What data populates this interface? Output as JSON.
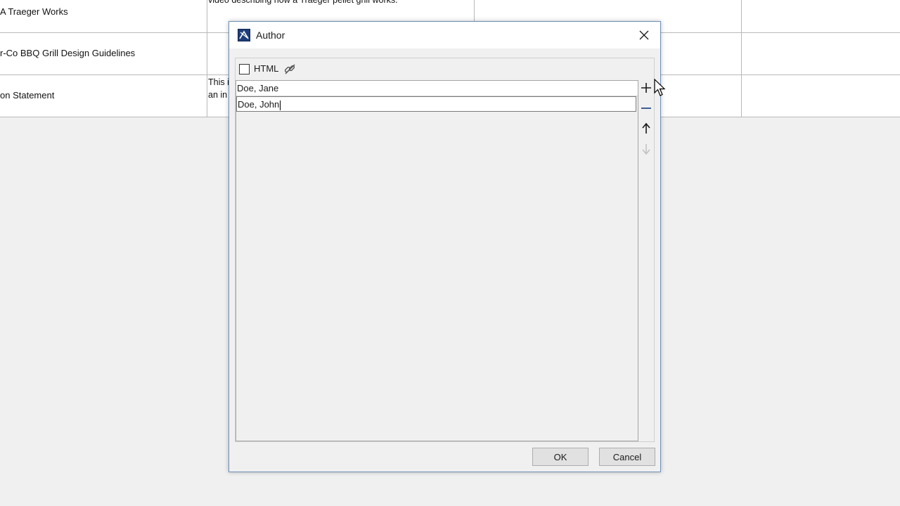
{
  "background_table": {
    "rows": [
      {
        "name": "A Traeger Works",
        "description": "video describing how a Traeger pellet grill works."
      },
      {
        "name": "r-Co BBQ Grill Design Guidelines",
        "description": ""
      },
      {
        "name": "on Statement",
        "description_line1": "This i",
        "description_line2": "an in"
      }
    ]
  },
  "dialog": {
    "title": "Author",
    "app_icon": "magicdraw-app-icon",
    "close_icon": "close-icon",
    "html_label": "HTML",
    "link_icon": "link-icon",
    "items": [
      "Doe, Jane",
      "Doe, John"
    ],
    "buttons": {
      "add_icon": "plus-icon",
      "remove_icon": "minus-icon",
      "up_icon": "arrow-up-icon",
      "down_icon": "arrow-down-icon",
      "ok": "OK",
      "cancel": "Cancel"
    }
  },
  "colors": {
    "dialog_border": "#6e8fb8",
    "button_face": "#e1e1e1",
    "add_remove_accent": "#2a4f8a"
  }
}
